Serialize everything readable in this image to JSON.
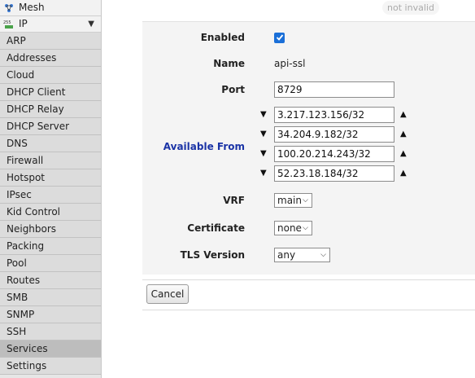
{
  "sidebar": {
    "mesh_label": "Mesh",
    "ip_label": "IP",
    "items": [
      {
        "label": "ARP"
      },
      {
        "label": "Addresses"
      },
      {
        "label": "Cloud"
      },
      {
        "label": "DHCP Client"
      },
      {
        "label": "DHCP Relay"
      },
      {
        "label": "DHCP Server"
      },
      {
        "label": "DNS"
      },
      {
        "label": "Firewall"
      },
      {
        "label": "Hotspot"
      },
      {
        "label": "IPsec"
      },
      {
        "label": "Kid Control"
      },
      {
        "label": "Neighbors"
      },
      {
        "label": "Packing"
      },
      {
        "label": "Pool"
      },
      {
        "label": "Routes"
      },
      {
        "label": "SMB"
      },
      {
        "label": "SNMP"
      },
      {
        "label": "SSH"
      },
      {
        "label": "Services"
      },
      {
        "label": "Settings"
      }
    ],
    "active_item": "Services"
  },
  "status_badge": "not invalid",
  "form": {
    "enabled": {
      "label": "Enabled",
      "checked": true
    },
    "name": {
      "label": "Name",
      "value": "api-ssl"
    },
    "port": {
      "label": "Port",
      "value": "8729"
    },
    "available_from": {
      "label": "Available From",
      "values": [
        "3.217.123.156/32",
        "34.204.9.182/32",
        "100.20.214.243/32",
        "52.23.18.184/32"
      ]
    },
    "vrf": {
      "label": "VRF",
      "value": "main"
    },
    "certificate": {
      "label": "Certificate",
      "value": "none"
    },
    "tls_version": {
      "label": "TLS Version",
      "value": "any"
    }
  },
  "buttons": {
    "cancel": "Cancel"
  },
  "colors": {
    "accent_label": "#1a33a6",
    "checkbox": "#1a6fd8",
    "active_item": "#bdbdbd"
  }
}
